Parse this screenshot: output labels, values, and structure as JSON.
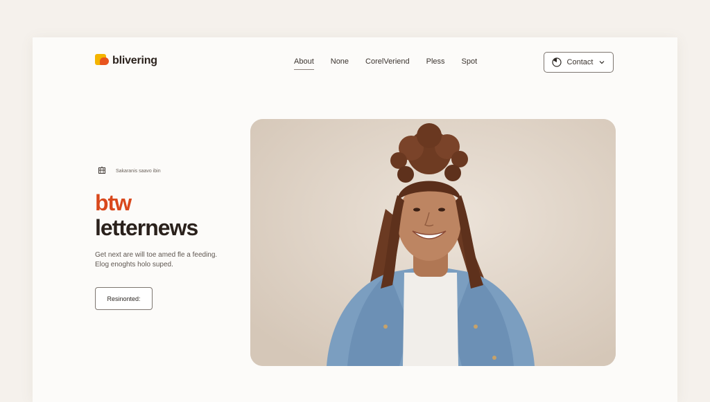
{
  "header": {
    "brand_name": "blivering",
    "nav": [
      {
        "label": "About",
        "active": true
      },
      {
        "label": "None",
        "active": false
      },
      {
        "label": "CorelVeriend",
        "active": false
      },
      {
        "label": "Pless",
        "active": false
      },
      {
        "label": "Spot",
        "active": false
      }
    ],
    "contact_label": "Contact"
  },
  "hero": {
    "eyebrow_text": "Sakaranis saavo ibin",
    "title_accent": "btw",
    "title_main": "letternews",
    "desc_line1": "Get next are will toe amed fle a feeding.",
    "desc_line2": "Elog enoghts holo suped.",
    "cta_label": "Resinonted:"
  },
  "colors": {
    "accent": "#d9481c",
    "logo_yellow": "#f4b400",
    "logo_orange": "#e8541e",
    "page_bg": "#f5f1ec"
  },
  "icons": {
    "eyebrow": "building-icon",
    "contact": "clock-icon",
    "contact_chevron": "chevron-down-icon"
  }
}
